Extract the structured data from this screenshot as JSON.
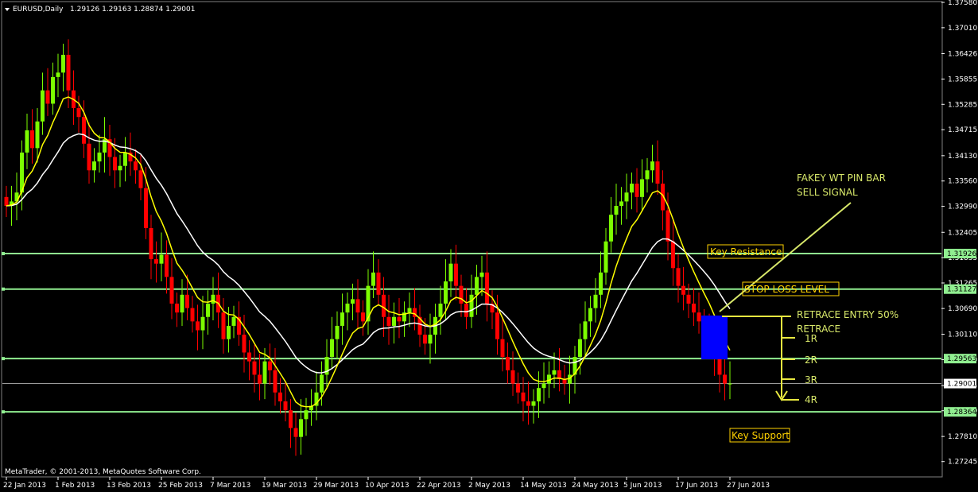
{
  "header": {
    "symbol": "EURUSD,Daily",
    "ohlc": "1.29126 1.29163 1.28874 1.29001"
  },
  "footer": {
    "copyright": "MetaTrader, © 2001-2013, MetaQuotes Software Corp."
  },
  "colors": {
    "background": "#000000",
    "bull": "#7cfc00",
    "bear": "#ff0000",
    "ma_fast": "#ffff00",
    "ma_slow": "#ffffff",
    "level": "#90ee90",
    "annotation": "#d8e86a",
    "entry_box": "#0000ff"
  },
  "annotations": {
    "signal_line1": "FAKEY WT PIN BAR",
    "signal_line2": "SELL SIGNAL",
    "key_resistance": "Key Resistance",
    "stop_loss": "STOP LOSS LEVEL",
    "retrace_line1": "RETRACE ENTRY 50%",
    "retrace_line2": "RETRACE",
    "r1": "1R",
    "r2": "2R",
    "r3": "3R",
    "r4": "4R",
    "key_support": "Key Support"
  },
  "chart_data": {
    "type": "candlestick",
    "symbol": "EURUSD",
    "timeframe": "Daily",
    "ylim": [
      1.269,
      1.3758
    ],
    "y_ticks": [
      1.3758,
      1.3701,
      1.36426,
      1.35855,
      1.35285,
      1.34715,
      1.3413,
      1.3356,
      1.3299,
      1.32405,
      1.31835,
      1.31265,
      1.3069,
      1.3011,
      1.2954,
      1.28955,
      1.2839,
      1.2781,
      1.27245
    ],
    "x_ticks": [
      "22 Jan 2013",
      "1 Feb 2013",
      "13 Feb 2013",
      "25 Feb 2013",
      "7 Mar 2013",
      "19 Mar 2013",
      "29 Mar 2013",
      "10 Apr 2013",
      "22 Apr 2013",
      "2 May 2013",
      "14 May 2013",
      "24 May 2013",
      "5 Jun 2013",
      "17 Jun 2013",
      "27 Jun 2013"
    ],
    "x_tick_index": [
      0,
      10,
      20,
      30,
      40,
      50,
      60,
      70,
      80,
      90,
      100,
      110,
      120,
      130,
      140
    ],
    "levels": [
      {
        "price": 1.31926,
        "label": "1.31926"
      },
      {
        "price": 1.31127,
        "label": "1.31127"
      },
      {
        "price": 1.29563,
        "label": "1.29563"
      },
      {
        "price": 1.28364,
        "label": "1.28364"
      }
    ],
    "current_price": {
      "price": 1.29001,
      "label": "1.29001"
    },
    "closes": [
      1.33,
      1.331,
      1.333,
      1.342,
      1.347,
      1.343,
      1.349,
      1.356,
      1.353,
      1.359,
      1.36,
      1.364,
      1.356,
      1.352,
      1.35,
      1.344,
      1.338,
      1.34,
      1.342,
      1.345,
      1.341,
      1.338,
      1.339,
      1.342,
      1.34,
      1.338,
      1.334,
      1.325,
      1.318,
      1.317,
      1.319,
      1.314,
      1.308,
      1.306,
      1.31,
      1.307,
      1.304,
      1.302,
      1.305,
      1.308,
      1.31,
      1.306,
      1.3,
      1.303,
      1.305,
      1.301,
      1.297,
      1.295,
      1.292,
      1.29,
      1.295,
      1.293,
      1.288,
      1.286,
      1.284,
      1.28,
      1.278,
      1.282,
      1.284,
      1.285,
      1.288,
      1.292,
      1.296,
      1.3,
      1.303,
      1.306,
      1.308,
      1.309,
      1.306,
      1.304,
      1.312,
      1.315,
      1.31,
      1.305,
      1.303,
      1.305,
      1.304,
      1.306,
      1.307,
      1.305,
      1.301,
      1.299,
      1.301,
      1.305,
      1.308,
      1.313,
      1.317,
      1.312,
      1.308,
      1.305,
      1.31,
      1.314,
      1.315,
      1.308,
      1.306,
      1.3,
      1.296,
      1.293,
      1.29,
      1.288,
      1.286,
      1.285,
      1.286,
      1.289,
      1.29,
      1.292,
      1.293,
      1.291,
      1.29,
      1.292,
      1.296,
      1.3,
      1.304,
      1.307,
      1.31,
      1.315,
      1.322,
      1.328,
      1.33,
      1.331,
      1.333,
      1.335,
      1.332,
      1.336,
      1.338,
      1.34,
      1.335,
      1.329,
      1.322,
      1.316,
      1.312,
      1.31,
      1.308,
      1.306,
      1.304,
      1.302,
      1.3,
      1.296,
      1.292,
      1.29,
      1.29
    ]
  }
}
